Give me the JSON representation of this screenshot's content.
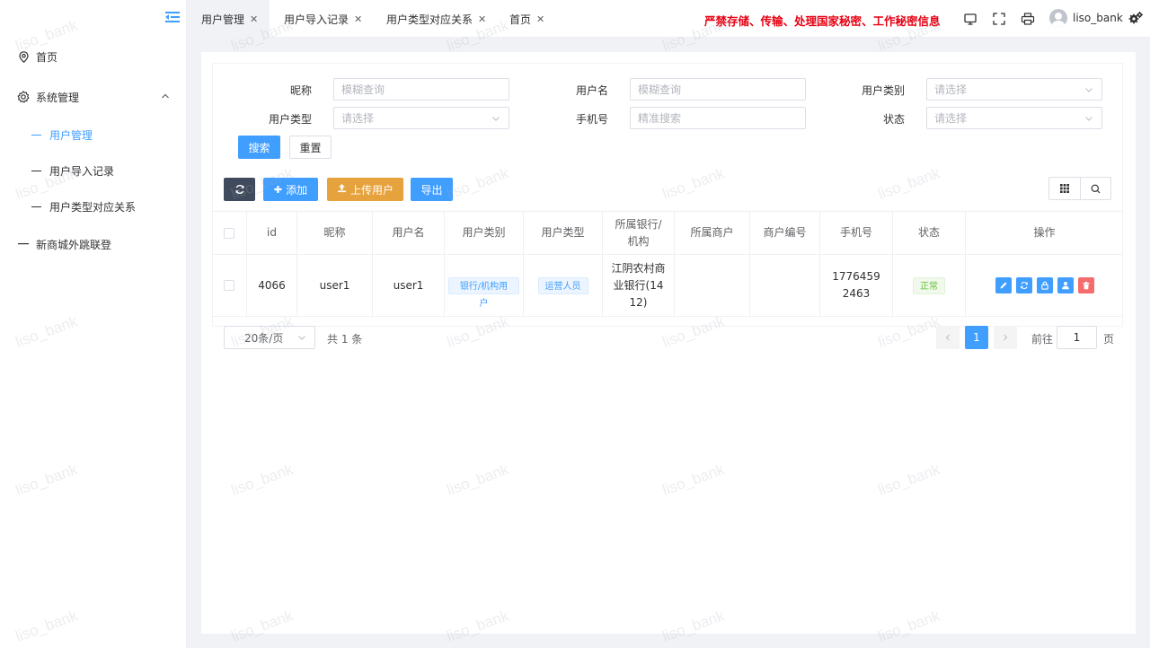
{
  "header": {
    "tabs": [
      {
        "label": "用户管理",
        "active": true
      },
      {
        "label": "用户导入记录",
        "active": false
      },
      {
        "label": "用户类型对应关系",
        "active": false
      },
      {
        "label": "首页",
        "active": false
      }
    ],
    "warning": "严禁存储、传输、处理国家秘密、工作秘密信息",
    "username": "liso_bank",
    "icons": [
      "monitor-icon",
      "fullscreen-icon",
      "printer-icon",
      "settings-gears-icon"
    ]
  },
  "sidebar": {
    "items": [
      {
        "label": "首页",
        "icon": "location-pin-icon"
      },
      {
        "label": "系统管理",
        "icon": "gear-icon",
        "expanded": true
      },
      {
        "label": "新商城外跳联登",
        "icon": "dash"
      }
    ],
    "subitems": [
      {
        "label": "用户管理",
        "active": true
      },
      {
        "label": "用户导入记录",
        "active": false
      },
      {
        "label": "用户类型对应关系",
        "active": false
      }
    ]
  },
  "filters": {
    "nickname": {
      "label": "昵称",
      "placeholder": "模糊查询"
    },
    "username": {
      "label": "用户名",
      "placeholder": "模糊查询"
    },
    "user_category": {
      "label": "用户类别",
      "placeholder": "请选择"
    },
    "user_type": {
      "label": "用户类型",
      "placeholder": "请选择"
    },
    "phone": {
      "label": "手机号",
      "placeholder": "精准搜索"
    },
    "status": {
      "label": "状态",
      "placeholder": "请选择"
    },
    "search_btn": "搜索",
    "reset_btn": "重置"
  },
  "toolbar": {
    "add": "添加",
    "upload": "上传用户",
    "export": "导出"
  },
  "table": {
    "columns": [
      "id",
      "昵称",
      "用户名",
      "用户类别",
      "用户类型",
      "所属银行/机构",
      "所属商户",
      "商户编号",
      "手机号",
      "状态",
      "操作"
    ],
    "rows": [
      {
        "id": "4066",
        "nickname": "user1",
        "username": "user1",
        "category": "银行/机构用户",
        "type": "运营人员",
        "bank": "江阴农村商业银行(1412)",
        "merchant": "",
        "merchant_no": "",
        "phone": "17764592463",
        "status": "正常"
      }
    ]
  },
  "pagination": {
    "page_size": "20条/页",
    "total": "共 1 条",
    "current": "1",
    "goto_label": "前往",
    "goto_value": "1",
    "page_unit": "页"
  },
  "watermark": "liso_bank",
  "colors": {
    "primary": "#409eff",
    "warning_text": "#e60012",
    "dark_button": "#3f4a5c",
    "upload_button": "#e6a23c",
    "danger": "#f56c6c",
    "success": "#67c23a"
  }
}
